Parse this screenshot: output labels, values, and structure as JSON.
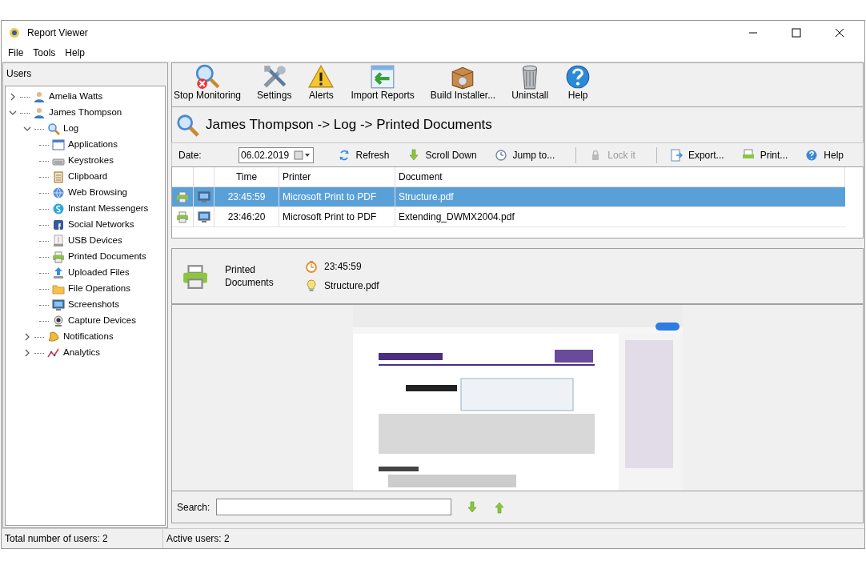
{
  "window": {
    "title": "Report Viewer"
  },
  "menu": [
    "File",
    "Tools",
    "Help"
  ],
  "users_panel": {
    "title": "Users",
    "tree": [
      {
        "label": "Amelia Watts",
        "expanded": false
      },
      {
        "label": "James Thompson",
        "expanded": true,
        "children": [
          {
            "label": "Log",
            "expanded": true,
            "children": [
              {
                "label": "Applications"
              },
              {
                "label": "Keystrokes"
              },
              {
                "label": "Clipboard"
              },
              {
                "label": "Web Browsing"
              },
              {
                "label": "Instant Messengers"
              },
              {
                "label": "Social Networks"
              },
              {
                "label": "USB Devices"
              },
              {
                "label": "Printed Documents"
              },
              {
                "label": "Uploaded Files"
              },
              {
                "label": "File Operations"
              },
              {
                "label": "Screenshots"
              },
              {
                "label": "Capture Devices"
              }
            ]
          },
          {
            "label": "Notifications",
            "expanded": false
          },
          {
            "label": "Analytics",
            "expanded": false
          }
        ]
      }
    ]
  },
  "toolbar": [
    "Stop Monitoring",
    "Settings",
    "Alerts",
    "Import Reports",
    "Build Installer...",
    "Uninstall",
    "Help"
  ],
  "breadcrumb": "James Thompson -> Log -> Printed Documents",
  "filter_bar": {
    "date_label": "Date:",
    "date": "06.02.2019",
    "actions": [
      {
        "label": "Refresh",
        "disabled": false
      },
      {
        "label": "Scroll Down",
        "disabled": false
      },
      {
        "label": "Jump to...",
        "disabled": false
      },
      {
        "label": "Lock it",
        "disabled": true
      },
      {
        "label": "Export...",
        "disabled": false
      },
      {
        "label": "Print...",
        "disabled": false
      },
      {
        "label": "Help",
        "disabled": false
      }
    ]
  },
  "table": {
    "columns": [
      "Time",
      "Printer",
      "Document"
    ],
    "rows": [
      {
        "time": "23:45:59",
        "printer": "Microsoft Print to PDF",
        "document": "Structure.pdf",
        "selected": true
      },
      {
        "time": "23:46:20",
        "printer": "Microsoft Print to PDF",
        "document": "Extending_DWMX2004.pdf",
        "selected": false
      }
    ]
  },
  "details": {
    "title": "Printed Documents",
    "time": "23:45:59",
    "document": "Structure.pdf"
  },
  "preview": {
    "kind": "picture"
  },
  "search": {
    "label": "Search:"
  },
  "status_bar": [
    "Total number of users: 2",
    "Active users: 2"
  ]
}
